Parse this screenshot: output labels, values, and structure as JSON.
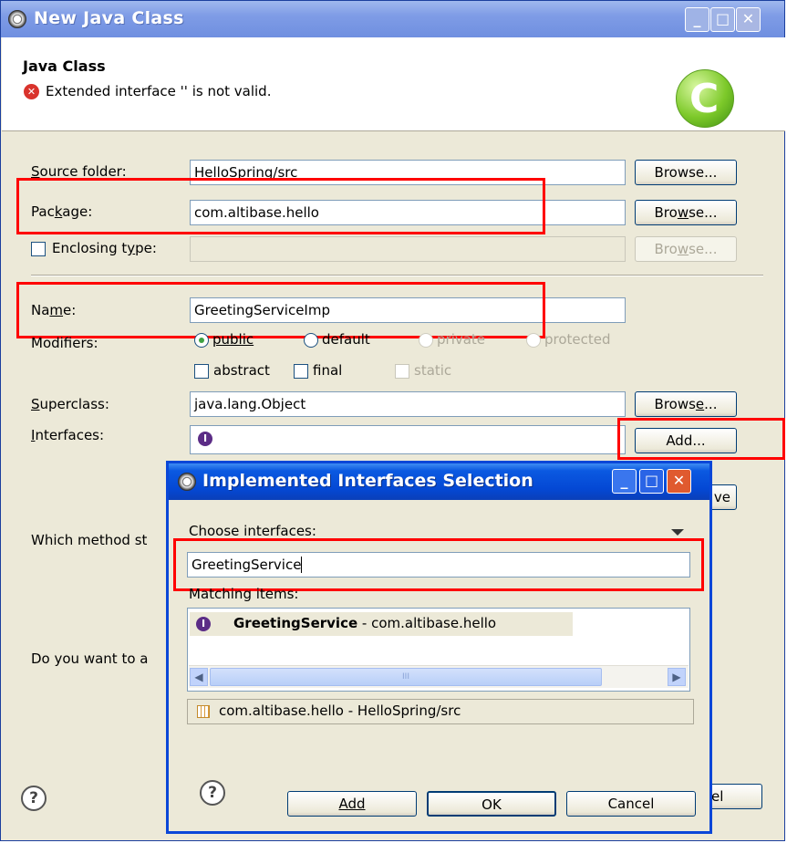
{
  "outer_dialog": {
    "title": "New Java Class",
    "header_title": "Java Class",
    "error_message": "Extended interface '' is not valid.",
    "source_folder": {
      "label_prefix": "S",
      "label_rest": "ource folder:",
      "value": "HelloSpring/src",
      "button": "Browse..."
    },
    "package": {
      "label_a": "Pac",
      "label_u": "k",
      "label_b": "age:",
      "value": "com.altibase.hello",
      "button_a": "Bro",
      "button_u": "w",
      "button_b": "se..."
    },
    "enclosing_type": {
      "label_a": "Enclosing t",
      "label_u": "y",
      "label_b": "pe:",
      "value": "",
      "button_a": "Bro",
      "button_u": "w",
      "button_b": "se...",
      "checked": false
    },
    "name": {
      "label_a": "Na",
      "label_u": "m",
      "label_b": "e:",
      "value": "GreetingServiceImp"
    },
    "modifiers": {
      "label": "Modifiers:",
      "public": "public",
      "default": "default",
      "private": "private",
      "protected": "protected",
      "abstract": "abstract",
      "final": "final",
      "static": "static",
      "selected": "public"
    },
    "superclass": {
      "label_u": "S",
      "label_rest": "uperclass:",
      "value": "java.lang.Object",
      "button_a": "Brows",
      "button_u": "e",
      "button_b": "..."
    },
    "interfaces": {
      "label_u": "I",
      "label_rest": "nterfaces:",
      "add_button": "Add...",
      "remove_button_partial": "ve"
    },
    "which_method_label": "Which method st",
    "do_you_want_label": "Do you want to a",
    "cancel_partial": "el"
  },
  "inner_dialog": {
    "title": "Implemented Interfaces Selection",
    "choose_label": "Choose interfaces:",
    "filter_value": "GreetingService",
    "matching_label": "Matching items:",
    "items": [
      {
        "name": "GreetingService",
        "package": " - com.altibase.hello",
        "icon": "interface-icon"
      }
    ],
    "scroll_thumb_text": "III",
    "status_text": "com.altibase.hello - HelloSpring/src",
    "buttons": {
      "add": "Add",
      "ok": "OK",
      "cancel": "Cancel"
    }
  },
  "colors": {
    "highlight": "#ff0000",
    "title_active": "#0448d4",
    "title_inactive": "#7f9ce6"
  }
}
